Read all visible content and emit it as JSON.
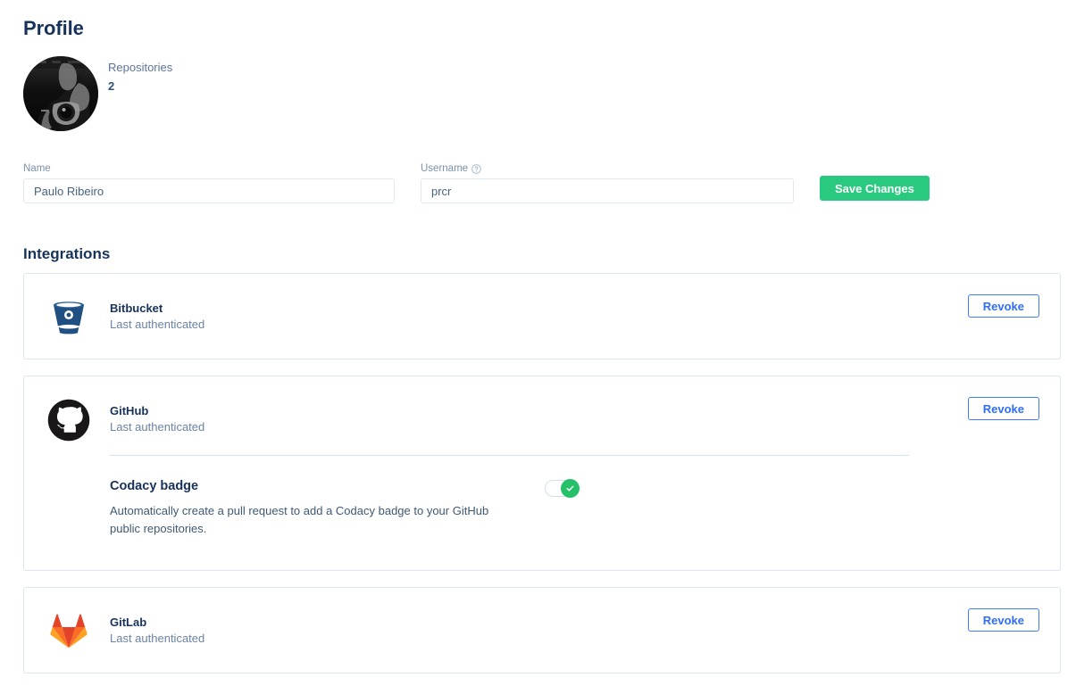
{
  "page": {
    "title": "Profile",
    "integrations_heading": "Integrations"
  },
  "profile": {
    "avatar_alt": "user-avatar-photo",
    "stats": {
      "repositories_label": "Repositories",
      "repositories_count": "2"
    },
    "form": {
      "name_label": "Name",
      "name_value": "Paulo Ribeiro",
      "name_placeholder": "Name",
      "username_label": "Username",
      "username_help_icon": "question-circle-icon",
      "username_value": "prcr",
      "username_placeholder": "Username",
      "save_label": "Save Changes"
    }
  },
  "integrations": [
    {
      "id": "bitbucket",
      "name": "Bitbucket",
      "status": "Last authenticated",
      "icon": "bitbucket-icon",
      "action_label": "Revoke",
      "accent": "#205081"
    },
    {
      "id": "github",
      "name": "GitHub",
      "status": "Last authenticated",
      "icon": "github-icon",
      "action_label": "Revoke",
      "accent": "#191717",
      "badge": {
        "title": "Codacy badge",
        "description": "Automatically create a pull request to add a Codacy badge to your GitHub public repositories.",
        "toggle_state": "on",
        "toggle_icon": "check-icon"
      }
    },
    {
      "id": "gitlab",
      "name": "GitLab",
      "status": "Last authenticated",
      "icon": "gitlab-icon",
      "action_label": "Revoke",
      "accent": "#e24329"
    }
  ],
  "colors": {
    "heading": "#17325b",
    "muted_text": "#6a82a3",
    "label": "#7a8fab",
    "primary_green": "#29c97f",
    "link_blue": "#2f6df6",
    "card_border": "#dce6f1",
    "toggle_green": "#25c16a"
  }
}
